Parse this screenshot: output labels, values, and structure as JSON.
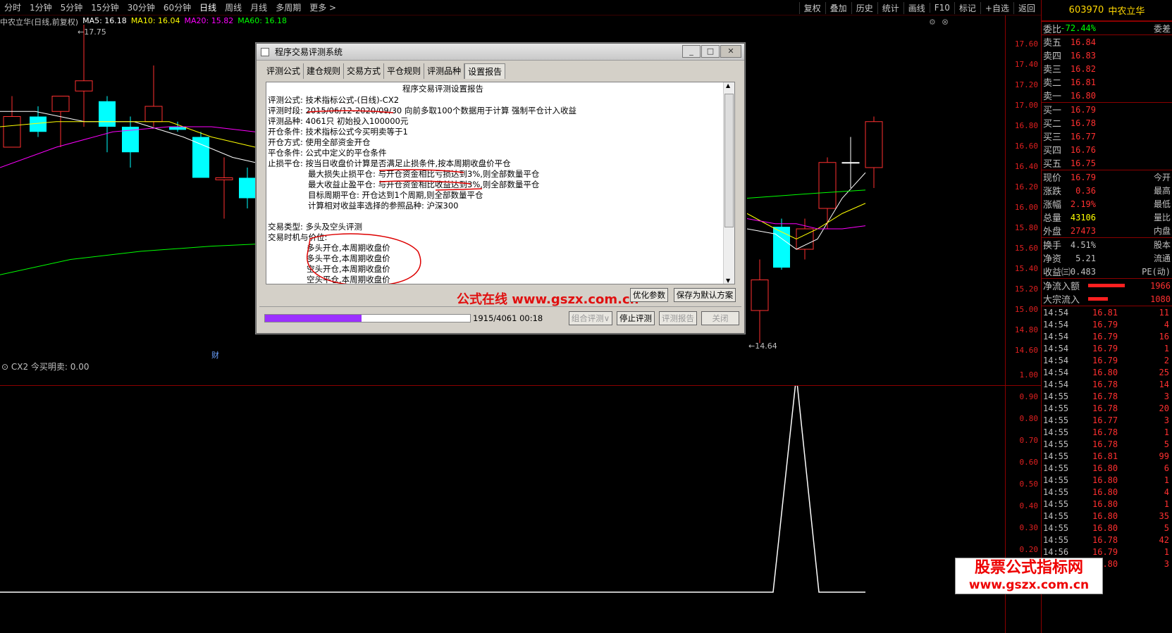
{
  "topbar": {
    "periods": [
      "分时",
      "1分钟",
      "5分钟",
      "15分钟",
      "30分钟",
      "60分钟",
      "日线",
      "周线",
      "月线",
      "多周期",
      "更多 >"
    ],
    "selected": "日线",
    "tools": [
      "复权",
      "叠加",
      "历史",
      "统计",
      "画线",
      "F10",
      "标记",
      "+自选",
      "返回"
    ]
  },
  "chart": {
    "title": "中农立华(日线,前复权)",
    "ma": [
      {
        "label": "MA5: 16.18",
        "color": "#ffffff"
      },
      {
        "label": "MA10: 16.04",
        "color": "#ffff00"
      },
      {
        "label": "MA20: 15.82",
        "color": "#ff00ff"
      },
      {
        "label": "MA60: 16.18",
        "color": "#00ff00"
      }
    ],
    "high_label": "17.75",
    "low_label": "14.64",
    "cai": "财",
    "price_axis": [
      "17.60",
      "17.40",
      "17.20",
      "17.00",
      "16.80",
      "16.60",
      "16.40",
      "16.20",
      "16.00",
      "15.80",
      "15.60",
      "15.40",
      "15.20",
      "15.00",
      "14.80",
      "14.60"
    ]
  },
  "indicator": {
    "title": "CX2  今买明卖: 0.00",
    "axis": [
      "1.00",
      "0.90",
      "0.80",
      "0.70",
      "0.60",
      "0.50",
      "0.40",
      "0.30",
      "0.20"
    ]
  },
  "quote": {
    "code": "603970",
    "name": "中农立华",
    "weibi": {
      "label": "委比",
      "value": "-72.44%",
      "right": "委差"
    },
    "sells": [
      {
        "label": "卖五",
        "price": "16.84"
      },
      {
        "label": "卖四",
        "price": "16.83"
      },
      {
        "label": "卖三",
        "price": "16.82"
      },
      {
        "label": "卖二",
        "price": "16.81"
      },
      {
        "label": "卖一",
        "price": "16.80"
      }
    ],
    "buys": [
      {
        "label": "买一",
        "price": "16.79"
      },
      {
        "label": "买二",
        "price": "16.78"
      },
      {
        "label": "买三",
        "price": "16.77"
      },
      {
        "label": "买四",
        "price": "16.76"
      },
      {
        "label": "买五",
        "price": "16.75"
      }
    ],
    "stats": [
      {
        "label": "现价",
        "value": "16.79",
        "right": "今开"
      },
      {
        "label": "涨跌",
        "value": "0.36",
        "right": "最高"
      },
      {
        "label": "涨幅",
        "value": "2.19%",
        "right": "最低"
      },
      {
        "label": "总量",
        "value": "43106",
        "right": "量比"
      },
      {
        "label": "外盘",
        "value": "27473",
        "right": "内盘"
      }
    ],
    "stats2": [
      {
        "label": "换手",
        "value": "4.51%",
        "right": "股本"
      },
      {
        "label": "净资",
        "value": "5.21",
        "right": "流通"
      },
      {
        "label": "收益㈢",
        "value": "0.483",
        "right": "PE(动)"
      }
    ],
    "flows": [
      {
        "label": "净流入额",
        "value": "1966"
      },
      {
        "label": "大宗流入",
        "value": "1080"
      }
    ],
    "trades": [
      [
        "14:54",
        "16.81",
        "11"
      ],
      [
        "14:54",
        "16.79",
        "4"
      ],
      [
        "14:54",
        "16.79",
        "16"
      ],
      [
        "14:54",
        "16.79",
        "1"
      ],
      [
        "14:54",
        "16.79",
        "2"
      ],
      [
        "14:54",
        "16.80",
        "25"
      ],
      [
        "14:54",
        "16.78",
        "14"
      ],
      [
        "14:55",
        "16.78",
        "3"
      ],
      [
        "14:55",
        "16.78",
        "20"
      ],
      [
        "14:55",
        "16.77",
        "3"
      ],
      [
        "14:55",
        "16.78",
        "1"
      ],
      [
        "14:55",
        "16.78",
        "5"
      ],
      [
        "14:55",
        "16.81",
        "99"
      ],
      [
        "14:55",
        "16.80",
        "6"
      ],
      [
        "14:55",
        "16.80",
        "1"
      ],
      [
        "14:55",
        "16.80",
        "4"
      ],
      [
        "14:55",
        "16.80",
        "1"
      ],
      [
        "14:55",
        "16.80",
        "35"
      ],
      [
        "14:55",
        "16.80",
        "5"
      ],
      [
        "14:55",
        "16.78",
        "42"
      ],
      [
        "14:56",
        "16.79",
        "1"
      ],
      [
        "14:56",
        "16.80",
        "3"
      ]
    ]
  },
  "dialog": {
    "title": "程序交易评测系统",
    "tabs": [
      "评测公式",
      "建仓规则",
      "交易方式",
      "平仓规则",
      "评测品种",
      "设置报告"
    ],
    "active_tab": "设置报告",
    "report": {
      "heading": "程序交易评测设置报告",
      "lines": [
        "评测公式: 技术指标公式-(日线)-CX2",
        "评测时段: 2015/06/12-2020/09/30 向前多取100个数据用于计算 强制平仓计入收益",
        "评测品种: 4061只 初始投入100000元",
        "开仓条件: 技术指标公式今买明卖等于1",
        "开仓方式: 使用全部资金开仓",
        "平仓条件: 公式中定义的平仓条件",
        "止损平仓: 按当日收盘价计算是否满足止损条件,按本周期收盘价平仓"
      ],
      "sub_lines": [
        "最大损失止损平仓: 与开仓资金相比亏损达到3%,则全部数量平仓",
        "最大收益止盈平仓: 与开仓资金相比收益达到3%,则全部数量平仓",
        "目标周期平仓: 开仓达到1个周期,则全部数量平仓",
        "计算相对收益率选择的参照品种: 沪深300"
      ],
      "trade_type": "交易类型: 多头及空头评测",
      "timing": "交易时机与价位:",
      "timing_lines": [
        "多头开仓,本周期收盘价",
        "多头平仓,本周期收盘价",
        "空头开仓,本周期收盘价",
        "空头平仓,本周期收盘价"
      ]
    },
    "watermark": "公式在线  www.gszx.com.cn",
    "btn_opt": "优化参数",
    "btn_save": "保存为默认方案",
    "progress": 0.471,
    "progress_text": "1915/4061  00:18",
    "btn_combo": "组合评测∨",
    "btn_stop": "停止评测",
    "btn_report": "评测报告",
    "btn_close": "关闭"
  },
  "corner_watermark": {
    "line1": "股票公式指标网",
    "line2": "www.gszx.com.cn"
  }
}
